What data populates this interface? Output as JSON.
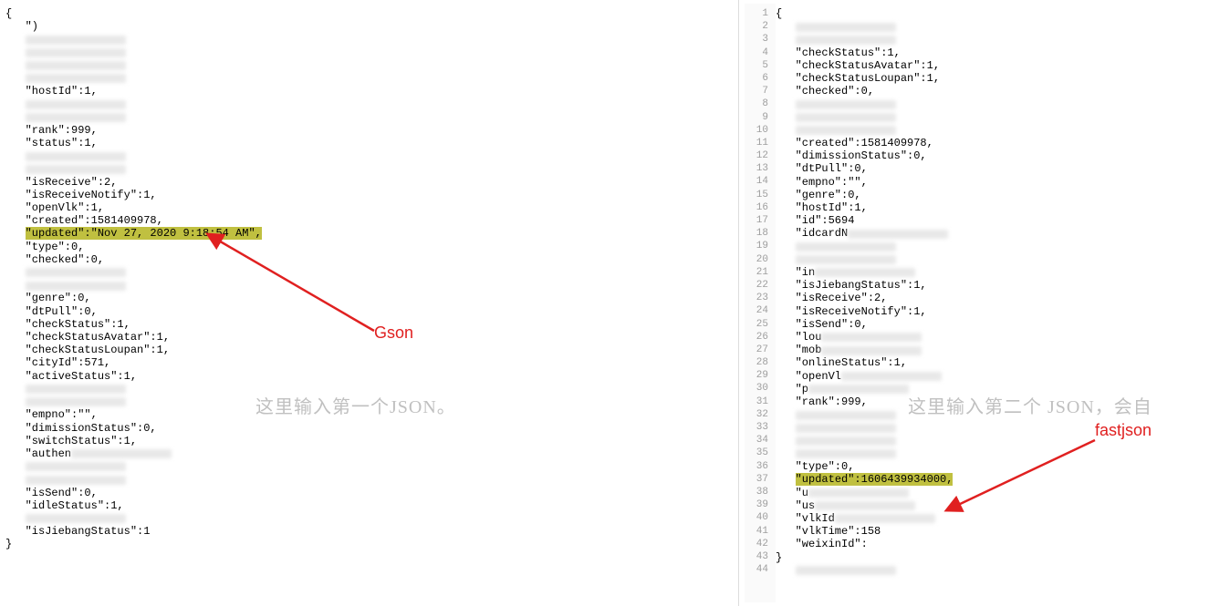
{
  "left": {
    "placeholder": "这里输入第一个JSON。",
    "label": "Gson",
    "highlight": "\"updated\":\"Nov 27, 2020 9:18:54 AM\",",
    "lines_before_hl": [
      "{",
      "   \")",
      "   ",
      "   ",
      "   ",
      "   ",
      "   \"hostId\":1,",
      "   ",
      "   ",
      "   \"rank\":999,",
      "   \"status\":1,",
      "   ",
      "   ",
      "   \"isReceive\":2,",
      "   \"isReceiveNotify\":1,",
      "   \"openVlk\":1,",
      "   \"created\":1581409978,"
    ],
    "lines_after_hl": [
      "   \"type\":0,",
      "   \"checked\":0,",
      "   ",
      "   ",
      "   \"genre\":0,",
      "   \"dtPull\":0,",
      "   \"checkStatus\":1,",
      "   \"checkStatusAvatar\":1,",
      "   \"checkStatusLoupan\":1,",
      "   \"cityId\":571,",
      "   \"activeStatus\":1,",
      "   ",
      "   ",
      "   \"empno\":\"\",",
      "   \"dimissionStatus\":0,",
      "   \"switchStatus\":1,",
      "   \"authen",
      "   ",
      "   ",
      "   \"isSend\":0,",
      "   \"idleStatus\":1,",
      "   ",
      "   \"isJiebangStatus\":1",
      "}"
    ]
  },
  "right": {
    "placeholder": "这里输入第二个 JSON，会自",
    "label": "fastjson",
    "highlight": "\"updated\":1606439934000,",
    "line_numbers": [
      "1",
      "2",
      "3",
      "4",
      "5",
      "6",
      "7",
      "8",
      "9",
      "10",
      "11",
      "12",
      "13",
      "14",
      "15",
      "16",
      "17",
      "18",
      "19",
      "20",
      "21",
      "22",
      "23",
      "24",
      "25",
      "26",
      "27",
      "28",
      "29",
      "30",
      "31",
      "32",
      "33",
      "34",
      "35",
      "36",
      "37",
      "38",
      "39",
      "40",
      "41",
      "42",
      "43",
      "44"
    ],
    "lines_before_hl": [
      "{",
      "   ",
      "   ",
      "   \"checkStatus\":1,",
      "   \"checkStatusAvatar\":1,",
      "   \"checkStatusLoupan\":1,",
      "   \"checked\":0,",
      "   ",
      "   ",
      "   ",
      "   \"created\":1581409978,",
      "   \"dimissionStatus\":0,",
      "   \"dtPull\":0,",
      "   \"empno\":\"\",",
      "   \"genre\":0,",
      "   \"hostId\":1,",
      "   \"id\":5694",
      "   \"idcardN",
      "   ",
      "   ",
      "   \"in",
      "   \"isJiebangStatus\":1,",
      "   \"isReceive\":2,",
      "   \"isReceiveNotify\":1,",
      "   \"isSend\":0,",
      "   \"lou",
      "   \"mob",
      "   \"onlineStatus\":1,",
      "   \"openVl",
      "   \"p",
      "   \"rank\":999,",
      "   ",
      "   ",
      "   ",
      "   ",
      "   \"type\":0,"
    ],
    "lines_after_hl": [
      "   \"u",
      "   \"us",
      "   \"vlkId",
      "   \"vlkTime\":158",
      "   \"weixinId\":",
      "}",
      ""
    ]
  }
}
